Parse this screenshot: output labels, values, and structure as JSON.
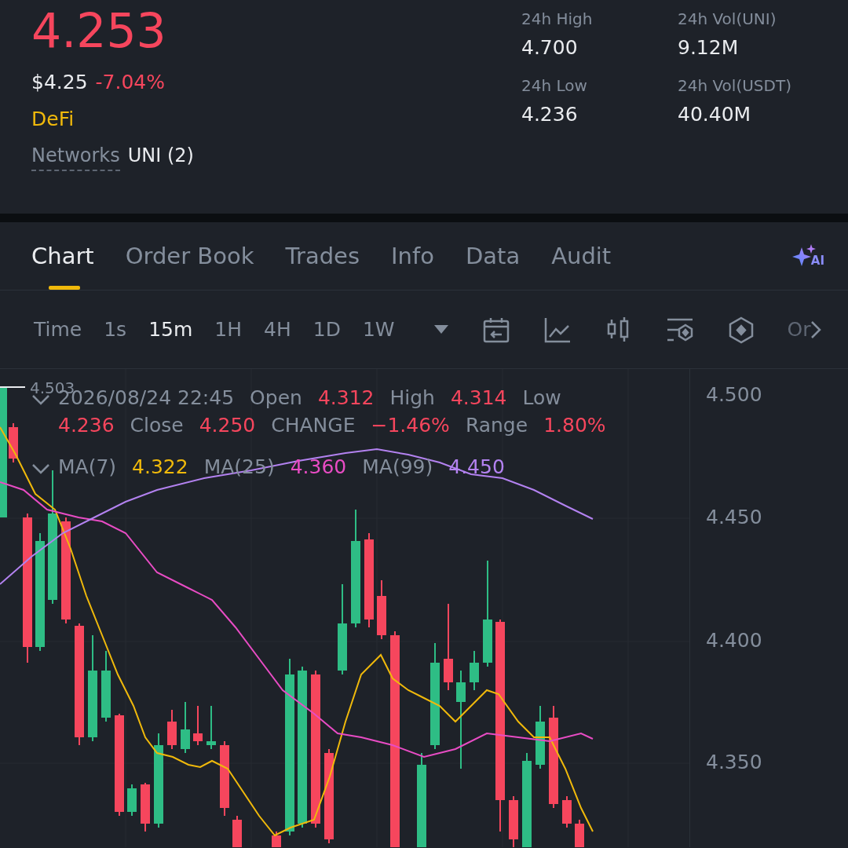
{
  "header": {
    "price": "4.253",
    "usd_price": "$4.25",
    "change": "-7.04%",
    "category": "DeFi",
    "networks_label": "Networks",
    "networks_value": "UNI (2)"
  },
  "stats": [
    {
      "label": "24h High",
      "value": "4.700"
    },
    {
      "label": "24h Vol(UNI)",
      "value": "9.12M"
    },
    {
      "label": "24h Low",
      "value": "4.236"
    },
    {
      "label": "24h Vol(USDT)",
      "value": "40.40M"
    }
  ],
  "tabs": [
    {
      "label": "Chart",
      "selected": true
    },
    {
      "label": "Order Book",
      "selected": false
    },
    {
      "label": "Trades",
      "selected": false
    },
    {
      "label": "Info",
      "selected": false
    },
    {
      "label": "Data",
      "selected": false
    },
    {
      "label": "Audit",
      "selected": false
    }
  ],
  "ai_badge": "AI",
  "toolbar": {
    "label": "Time",
    "intervals": [
      {
        "label": "1s",
        "selected": false
      },
      {
        "label": "15m",
        "selected": true
      },
      {
        "label": "1H",
        "selected": false
      },
      {
        "label": "4H",
        "selected": false
      },
      {
        "label": "1D",
        "selected": false
      },
      {
        "label": "1W",
        "selected": false
      }
    ],
    "more": "Or"
  },
  "chart": {
    "high_marker": "4.503",
    "datetime": "2026/08/24 22:45",
    "legend_lines": [
      {
        "items": [
          {
            "kind": "label",
            "text": "Open"
          },
          {
            "kind": "value",
            "text": "4.312"
          },
          {
            "kind": "label",
            "text": "High"
          },
          {
            "kind": "value",
            "text": "4.314"
          },
          {
            "kind": "label",
            "text": "Low"
          }
        ]
      },
      {
        "items": [
          {
            "kind": "value",
            "text": "4.236"
          },
          {
            "kind": "label",
            "text": "Close"
          },
          {
            "kind": "value",
            "text": "4.250"
          },
          {
            "kind": "label",
            "text": "CHANGE"
          },
          {
            "kind": "value",
            "text": "−1.46%"
          },
          {
            "kind": "label",
            "text": "Range"
          },
          {
            "kind": "value",
            "text": "1.80%"
          }
        ]
      }
    ],
    "ma": [
      {
        "label": "MA(7)",
        "value": "4.322",
        "color": "#f0b90b"
      },
      {
        "label": "MA(25)",
        "value": "4.360",
        "color": "#e84cc4"
      },
      {
        "label": "MA(99)",
        "value": "4.450",
        "color": "#b382f0"
      }
    ],
    "y_axis": [
      "4.500",
      "4.450",
      "4.400",
      "4.350"
    ]
  }
}
